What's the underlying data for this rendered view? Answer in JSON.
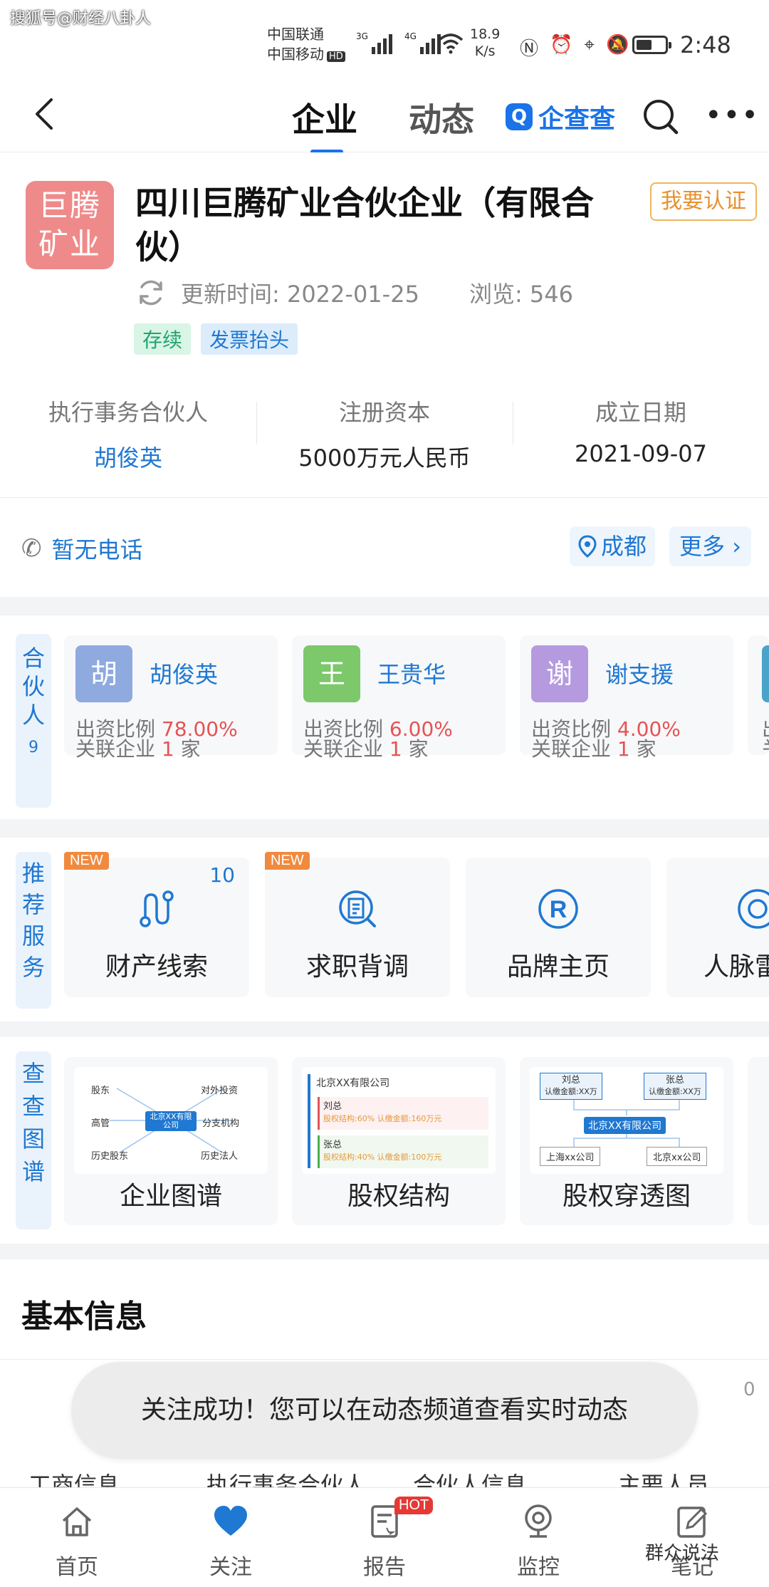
{
  "watermark_top": "搜狐号@财经八卦人",
  "status": {
    "carrier1": "中国联通",
    "carrier2": "中国移动",
    "hd": "HD",
    "net1": "3G",
    "net2": "4G",
    "speed_value": "18.9",
    "speed_unit": "K/s",
    "time": "2:48",
    "battery_level": 0.55
  },
  "nav": {
    "tab_active": "企业",
    "tab_inactive": "动态",
    "brand": "企查查",
    "brand_logo": "Q"
  },
  "company": {
    "logo_line1": "巨腾",
    "logo_line2": "矿业",
    "name": "四川巨腾矿业合伙企业（有限合伙）",
    "verify": "我要认证",
    "updated_label": "更新时间: 2022-01-25",
    "views_label": "浏览: 546",
    "tag_status": "存续",
    "tag_invoice": "发票抬头",
    "stats": [
      {
        "label": "执行事务合伙人",
        "value": "胡俊英"
      },
      {
        "label": "注册资本",
        "value": "5000万元人民币"
      },
      {
        "label": "成立日期",
        "value": "2021-09-07"
      }
    ]
  },
  "contact": {
    "phone": "暂无电话",
    "city": "成都",
    "more": "更多"
  },
  "partners": {
    "side_label": "合伙人",
    "count": "9",
    "share_label": "出资比例",
    "related_label": "关联企业",
    "related_unit": "家",
    "items": [
      {
        "avatar": "胡",
        "name": "胡俊英",
        "ratio": "78.00%",
        "related": "1",
        "color": "#8eaadf"
      },
      {
        "avatar": "王",
        "name": "王贵华",
        "ratio": "6.00%",
        "related": "1",
        "color": "#7cc86a"
      },
      {
        "avatar": "谢",
        "name": "谢支援",
        "ratio": "4.00%",
        "related": "1",
        "color": "#b59ae0"
      }
    ],
    "partial_prefix": "出",
    "partial_prefix2": "关"
  },
  "services": {
    "side_label": "推荐服务",
    "new_badge": "NEW",
    "items": [
      {
        "name": "财产线索",
        "icon": "asset-clue-icon",
        "count": "10"
      },
      {
        "name": "求职背调",
        "icon": "job-check-icon"
      },
      {
        "name": "品牌主页",
        "icon": "brand-r-icon"
      },
      {
        "name": "人脉雷",
        "icon": "network-radar-icon"
      }
    ]
  },
  "graphs": {
    "side_label": "查查图谱",
    "items": [
      {
        "name": "企业图谱"
      },
      {
        "name": "股权结构"
      },
      {
        "name": "股权穿透图"
      }
    ],
    "g1": {
      "center": "北京XX有限公司",
      "nodes": [
        "股东",
        "对外投资",
        "高管",
        "分支机构",
        "历史股东",
        "历史法人"
      ]
    },
    "g2": {
      "head": "北京XX有限公司",
      "p1": "刘总",
      "p1_detail": "股权结构:60% 认缴金额:160万元",
      "p2": "张总",
      "p2_detail": "股权结构:40% 认缴金额:100万元"
    },
    "g3": {
      "top_left": "刘总",
      "top_left_sub": "认缴金额:XX万",
      "top_right": "张总",
      "top_right_sub": "认缴金额:XX万",
      "center": "北京XX有限公司",
      "bottom_left": "上海xx公司",
      "bottom_right": "北京xx公司"
    }
  },
  "basic": {
    "title": "基本信息",
    "zero": "0",
    "row": [
      "工商信息",
      "执行事务合伙人",
      "合伙人信息",
      "主要人员"
    ]
  },
  "toast": "关注成功！您可以在动态频道查看实时动态",
  "tabbar": {
    "items": [
      {
        "label": "首页"
      },
      {
        "label": "关注"
      },
      {
        "label": "报告"
      },
      {
        "label": "监控"
      },
      {
        "label": "笔记"
      }
    ],
    "hot": "HOT"
  },
  "watermark_bottom": "群众说法"
}
